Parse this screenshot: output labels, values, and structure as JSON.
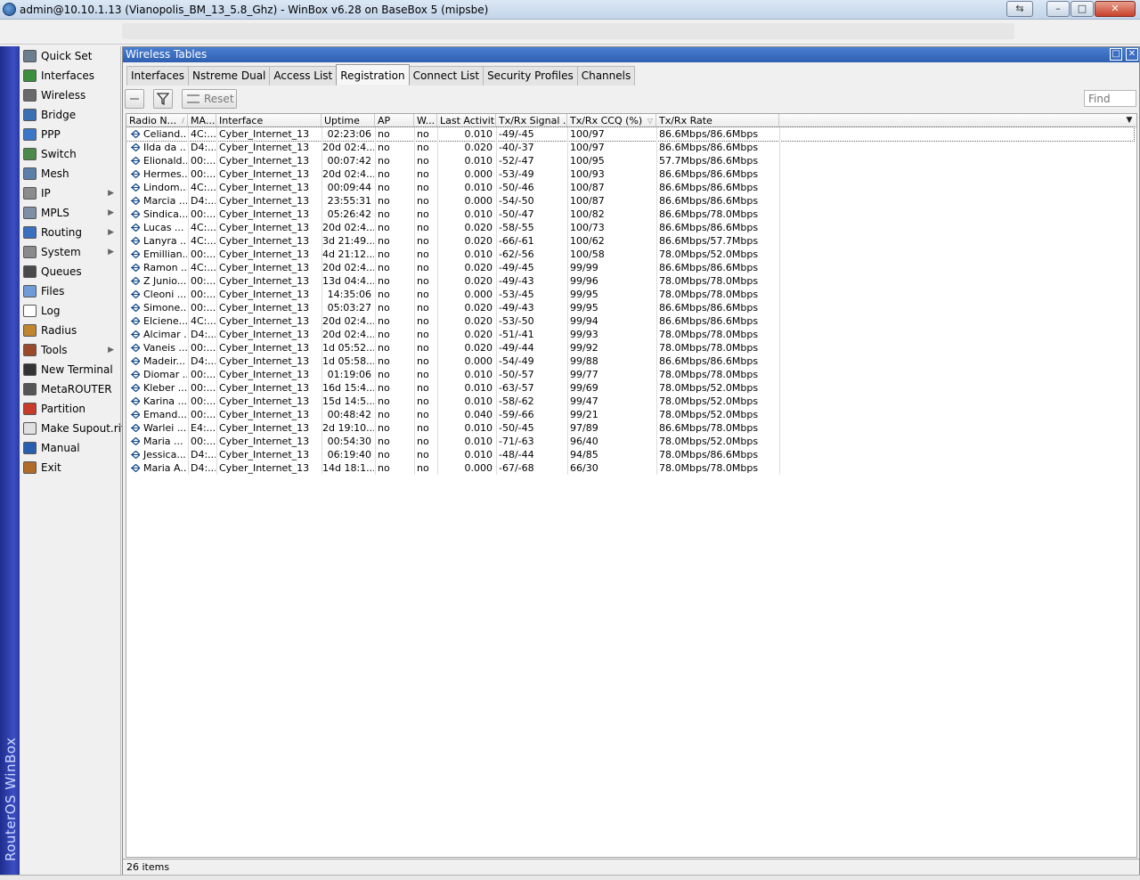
{
  "window": {
    "title": "admin@10.10.1.13 (Vianopolis_BM_13_5.8_Ghz) - WinBox v6.28 on BaseBox 5 (mipsbe)",
    "controls": {
      "minimize": "–",
      "maximize": "□",
      "close": "✕",
      "restore_session": "⇆"
    }
  },
  "banner": {
    "text": "RouterOS WinBox",
    "color": "#2a39a2"
  },
  "sidebar": {
    "items": [
      {
        "label": "Quick Set",
        "icon": "quick-set-icon",
        "color": "#6b7f8f",
        "arrow": ""
      },
      {
        "label": "Interfaces",
        "icon": "interfaces-icon",
        "color": "#3a8f3a",
        "arrow": ""
      },
      {
        "label": "Wireless",
        "icon": "wireless-icon",
        "color": "#6a6a6a",
        "arrow": ""
      },
      {
        "label": "Bridge",
        "icon": "bridge-icon",
        "color": "#3b6fb3",
        "arrow": ""
      },
      {
        "label": "PPP",
        "icon": "ppp-icon",
        "color": "#3b77c8",
        "arrow": ""
      },
      {
        "label": "Switch",
        "icon": "switch-icon",
        "color": "#4a8a4a",
        "arrow": ""
      },
      {
        "label": "Mesh",
        "icon": "mesh-icon",
        "color": "#5a7fa8",
        "arrow": ""
      },
      {
        "label": "IP",
        "icon": "ip-icon",
        "color": "#8c8c8c",
        "arrow": "▶"
      },
      {
        "label": "MPLS",
        "icon": "mpls-icon",
        "color": "#7e8fa6",
        "arrow": "▶"
      },
      {
        "label": "Routing",
        "icon": "routing-icon",
        "color": "#3b6fc0",
        "arrow": "▶"
      },
      {
        "label": "System",
        "icon": "system-icon",
        "color": "#8a8a8a",
        "arrow": "▶"
      },
      {
        "label": "Queues",
        "icon": "queues-icon",
        "color": "#4a4a4a",
        "arrow": ""
      },
      {
        "label": "Files",
        "icon": "files-icon",
        "color": "#6f9bd6",
        "arrow": ""
      },
      {
        "label": "Log",
        "icon": "log-icon",
        "color": "#ffffff",
        "arrow": ""
      },
      {
        "label": "Radius",
        "icon": "radius-icon",
        "color": "#c0862f",
        "arrow": ""
      },
      {
        "label": "Tools",
        "icon": "tools-icon",
        "color": "#9a4a2a",
        "arrow": "▶"
      },
      {
        "label": "New Terminal",
        "icon": "terminal-icon",
        "color": "#333333",
        "arrow": ""
      },
      {
        "label": "MetaROUTER",
        "icon": "metarouter-icon",
        "color": "#555555",
        "arrow": ""
      },
      {
        "label": "Partition",
        "icon": "partition-icon",
        "color": "#c83a2a",
        "arrow": ""
      },
      {
        "label": "Make Supout.rif",
        "icon": "supout-icon",
        "color": "#e0e0e0",
        "arrow": ""
      },
      {
        "label": "Manual",
        "icon": "manual-icon",
        "color": "#2a5fb0",
        "arrow": ""
      },
      {
        "label": "Exit",
        "icon": "exit-icon",
        "color": "#b06a2a",
        "arrow": ""
      }
    ]
  },
  "panel": {
    "title": "Wireless Tables",
    "tabs": [
      "Interfaces",
      "Nstreme Dual",
      "Access List",
      "Registration",
      "Connect List",
      "Security Profiles",
      "Channels"
    ],
    "active_tab": "Registration",
    "toolbar": {
      "reset_label": "Reset",
      "find_placeholder": "Find"
    },
    "columns": [
      "Radio N...",
      "MA...",
      "Interface",
      "Uptime",
      "AP",
      "W...",
      "Last Activit...",
      "Tx/Rx Signal ...",
      "Tx/Rx CCQ (%)",
      "Tx/Rx Rate"
    ],
    "rows": [
      [
        "Celiand...",
        "4C:...",
        "Cyber_Internet_13",
        "02:23:06",
        "no",
        "no",
        "0.010",
        "-49/-45",
        "100/97",
        "86.6Mbps/86.6Mbps"
      ],
      [
        "Ilda da ...",
        "D4:...",
        "Cyber_Internet_13",
        "20d 02:4...",
        "no",
        "no",
        "0.020",
        "-40/-37",
        "100/97",
        "86.6Mbps/86.6Mbps"
      ],
      [
        "Elionald...",
        "00:...",
        "Cyber_Internet_13",
        "00:07:42",
        "no",
        "no",
        "0.010",
        "-52/-47",
        "100/95",
        "57.7Mbps/86.6Mbps"
      ],
      [
        "Hermes...",
        "00:...",
        "Cyber_Internet_13",
        "20d 02:4...",
        "no",
        "no",
        "0.000",
        "-53/-49",
        "100/93",
        "86.6Mbps/86.6Mbps"
      ],
      [
        "Lindom...",
        "4C:...",
        "Cyber_Internet_13",
        "00:09:44",
        "no",
        "no",
        "0.010",
        "-50/-46",
        "100/87",
        "86.6Mbps/86.6Mbps"
      ],
      [
        "Marcia ...",
        "D4:...",
        "Cyber_Internet_13",
        "23:55:31",
        "no",
        "no",
        "0.000",
        "-54/-50",
        "100/87",
        "86.6Mbps/86.6Mbps"
      ],
      [
        "Sindica...",
        "00:...",
        "Cyber_Internet_13",
        "05:26:42",
        "no",
        "no",
        "0.010",
        "-50/-47",
        "100/82",
        "86.6Mbps/78.0Mbps"
      ],
      [
        "Lucas ...",
        "4C:...",
        "Cyber_Internet_13",
        "20d 02:4...",
        "no",
        "no",
        "0.020",
        "-58/-55",
        "100/73",
        "86.6Mbps/86.6Mbps"
      ],
      [
        "Lanyra ...",
        "4C:...",
        "Cyber_Internet_13",
        "3d 21:49...",
        "no",
        "no",
        "0.020",
        "-66/-61",
        "100/62",
        "86.6Mbps/57.7Mbps"
      ],
      [
        "Emillian...",
        "00:...",
        "Cyber_Internet_13",
        "4d 21:12...",
        "no",
        "no",
        "0.010",
        "-62/-56",
        "100/58",
        "78.0Mbps/52.0Mbps"
      ],
      [
        "Ramon ...",
        "4C:...",
        "Cyber_Internet_13",
        "20d 02:4...",
        "no",
        "no",
        "0.020",
        "-49/-45",
        "99/99",
        "86.6Mbps/86.6Mbps"
      ],
      [
        "Z Junio...",
        "00:...",
        "Cyber_Internet_13",
        "13d 04:4...",
        "no",
        "no",
        "0.020",
        "-49/-43",
        "99/96",
        "78.0Mbps/78.0Mbps"
      ],
      [
        "Cleoni ...",
        "00:...",
        "Cyber_Internet_13",
        "14:35:06",
        "no",
        "no",
        "0.000",
        "-53/-45",
        "99/95",
        "78.0Mbps/78.0Mbps"
      ],
      [
        "Simone...",
        "00:...",
        "Cyber_Internet_13",
        "05:03:27",
        "no",
        "no",
        "0.020",
        "-49/-43",
        "99/95",
        "86.6Mbps/86.6Mbps"
      ],
      [
        "Elciene...",
        "4C:...",
        "Cyber_Internet_13",
        "20d 02:4...",
        "no",
        "no",
        "0.020",
        "-53/-50",
        "99/94",
        "86.6Mbps/86.6Mbps"
      ],
      [
        "Alcimar ...",
        "D4:...",
        "Cyber_Internet_13",
        "20d 02:4...",
        "no",
        "no",
        "0.020",
        "-51/-41",
        "99/93",
        "78.0Mbps/78.0Mbps"
      ],
      [
        "Vaneis ...",
        "00:...",
        "Cyber_Internet_13",
        "1d 05:52...",
        "no",
        "no",
        "0.020",
        "-49/-44",
        "99/92",
        "78.0Mbps/78.0Mbps"
      ],
      [
        "Madeir...",
        "D4:...",
        "Cyber_Internet_13",
        "1d 05:58...",
        "no",
        "no",
        "0.000",
        "-54/-49",
        "99/88",
        "86.6Mbps/86.6Mbps"
      ],
      [
        "Diomar ...",
        "00:...",
        "Cyber_Internet_13",
        "01:19:06",
        "no",
        "no",
        "0.010",
        "-50/-57",
        "99/77",
        "78.0Mbps/78.0Mbps"
      ],
      [
        "Kleber ...",
        "00:...",
        "Cyber_Internet_13",
        "16d 15:4...",
        "no",
        "no",
        "0.010",
        "-63/-57",
        "99/69",
        "78.0Mbps/52.0Mbps"
      ],
      [
        "Karina ...",
        "00:...",
        "Cyber_Internet_13",
        "15d 14:5...",
        "no",
        "no",
        "0.010",
        "-58/-62",
        "99/47",
        "78.0Mbps/52.0Mbps"
      ],
      [
        "Emand...",
        "00:...",
        "Cyber_Internet_13",
        "00:48:42",
        "no",
        "no",
        "0.040",
        "-59/-66",
        "99/21",
        "78.0Mbps/52.0Mbps"
      ],
      [
        "Warlei ...",
        "E4:...",
        "Cyber_Internet_13",
        "2d 19:10...",
        "no",
        "no",
        "0.010",
        "-50/-45",
        "97/89",
        "86.6Mbps/78.0Mbps"
      ],
      [
        "Maria ...",
        "00:...",
        "Cyber_Internet_13",
        "00:54:30",
        "no",
        "no",
        "0.010",
        "-71/-63",
        "96/40",
        "78.0Mbps/52.0Mbps"
      ],
      [
        "Jessica...",
        "D4:...",
        "Cyber_Internet_13",
        "06:19:40",
        "no",
        "no",
        "0.010",
        "-48/-44",
        "94/85",
        "78.0Mbps/86.6Mbps"
      ],
      [
        "Maria A...",
        "D4:...",
        "Cyber_Internet_13",
        "14d 18:1...",
        "no",
        "no",
        "0.000",
        "-67/-68",
        "66/30",
        "78.0Mbps/78.0Mbps"
      ]
    ],
    "status": "26 items"
  }
}
